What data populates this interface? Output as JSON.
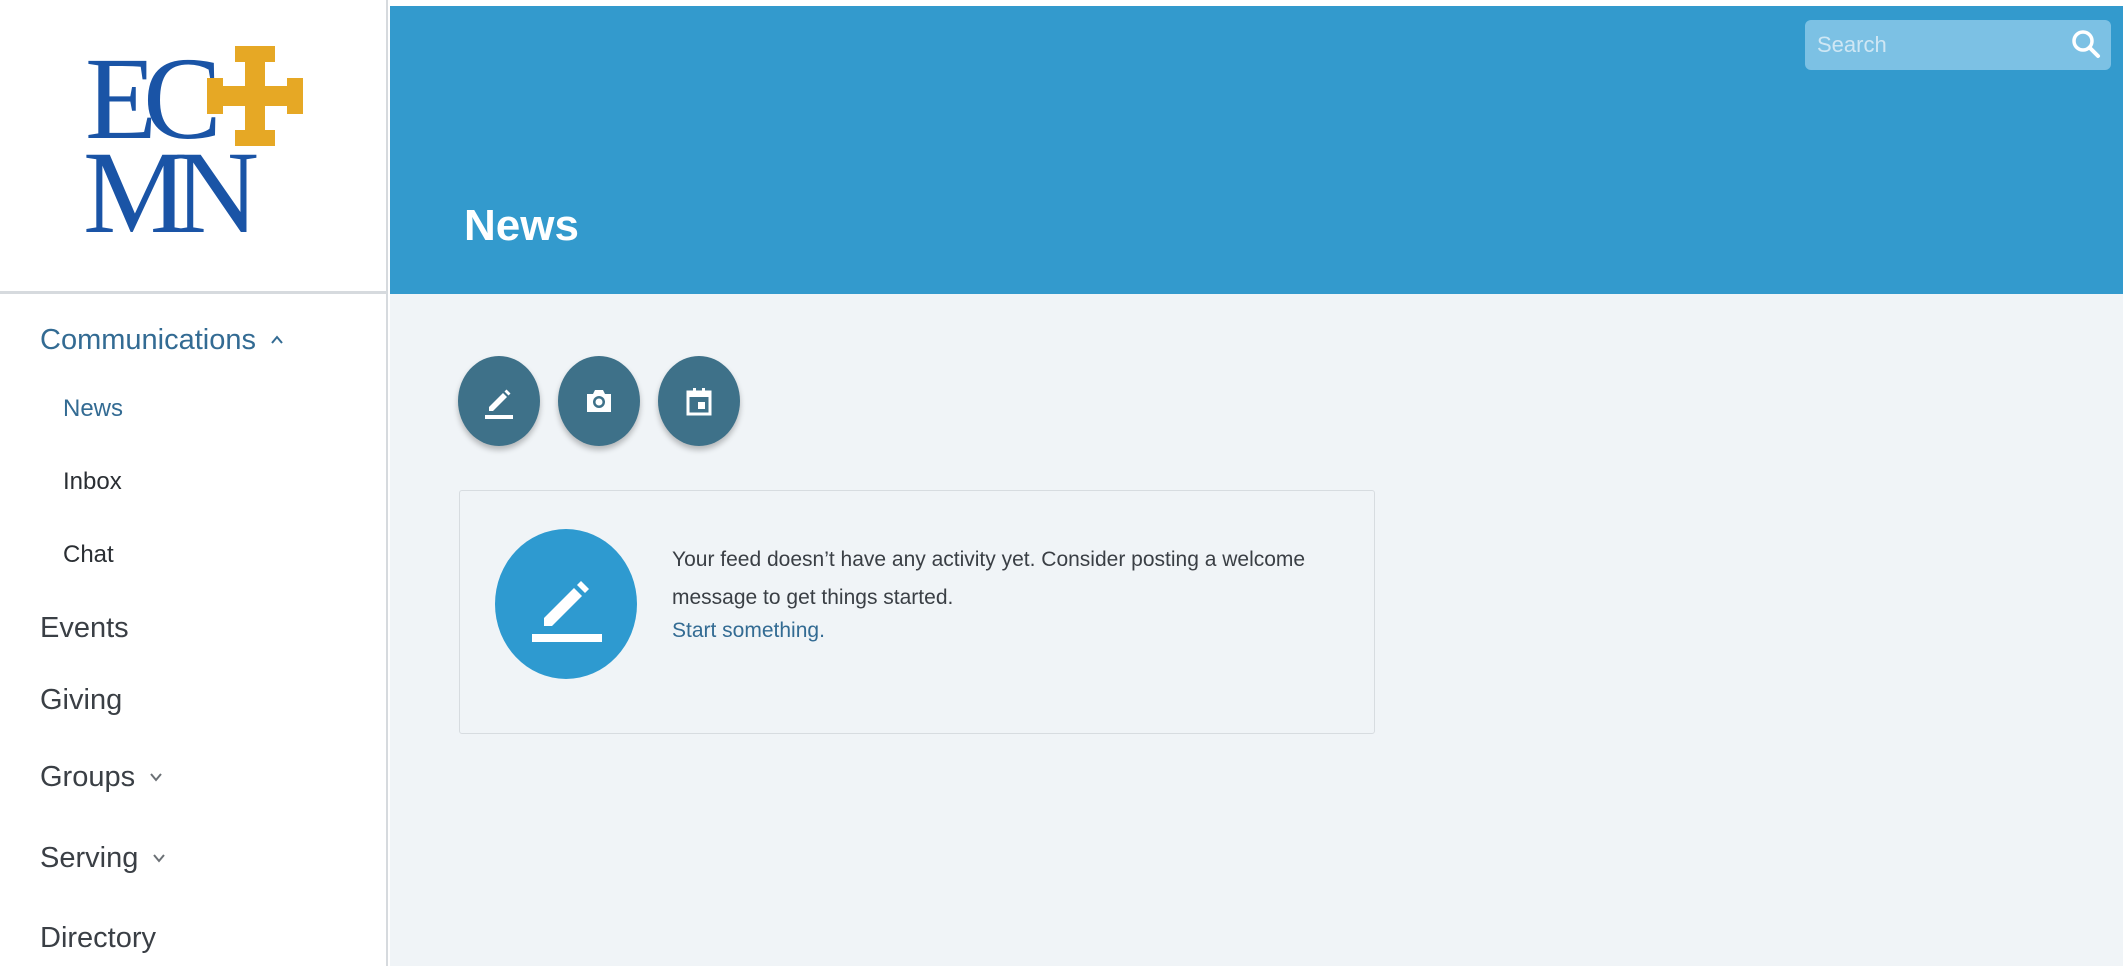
{
  "logo": {
    "alt": "ECMN logo",
    "line1": "EC",
    "line2": "MN",
    "brand_color": "#1a54a6",
    "cross_color": "#e6a825"
  },
  "sidebar": {
    "items": [
      {
        "label": "Communications",
        "type": "primary",
        "state": "expanded",
        "active": true
      },
      {
        "label": "News",
        "type": "sub",
        "active": true
      },
      {
        "label": "Inbox",
        "type": "sub",
        "active": false
      },
      {
        "label": "Chat",
        "type": "sub",
        "active": false
      },
      {
        "label": "Events",
        "type": "primary",
        "active": false
      },
      {
        "label": "Giving",
        "type": "primary",
        "active": false
      },
      {
        "label": "Groups",
        "type": "primary",
        "state": "collapsed",
        "active": false
      },
      {
        "label": "Serving",
        "type": "primary",
        "state": "collapsed",
        "active": false
      },
      {
        "label": "Directory",
        "type": "primary",
        "active": false
      }
    ]
  },
  "header": {
    "title": "News",
    "background": "#339acd",
    "search": {
      "placeholder": "Search",
      "icon": "search-icon"
    }
  },
  "actions": [
    {
      "icon": "pencil-icon",
      "label": "Post"
    },
    {
      "icon": "camera-icon",
      "label": "Photo"
    },
    {
      "icon": "calendar-icon",
      "label": "Event"
    }
  ],
  "feed": {
    "empty_message": "Your feed doesn’t have any activity yet. Consider posting a welcome message to get things started.",
    "link_text": "Start something.",
    "icon": "pencil-icon"
  },
  "colors": {
    "accent": "#336b93",
    "action_button": "#3e7189",
    "feed_badge": "#2e9ad0",
    "content_bg": "#f0f4f7"
  }
}
